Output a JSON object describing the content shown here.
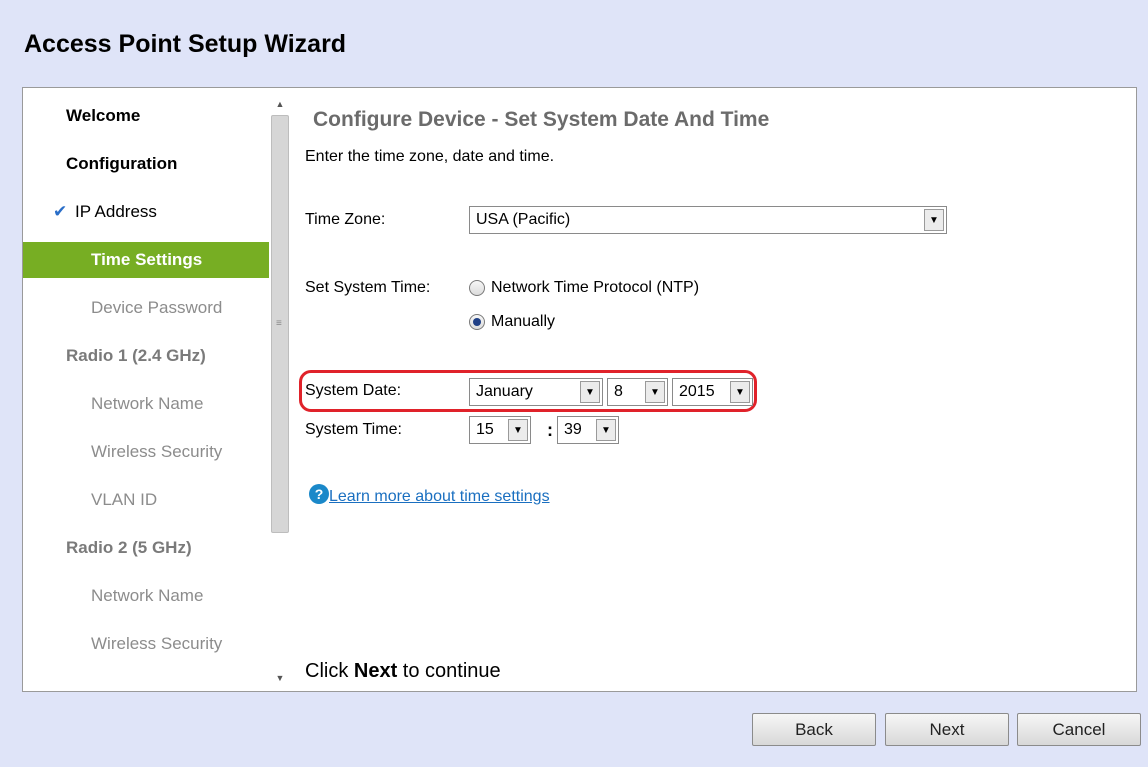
{
  "window": {
    "title": "Access Point Setup Wizard"
  },
  "sidebar": {
    "items": [
      {
        "label": "Welcome"
      },
      {
        "label": "Configuration"
      },
      {
        "label": "IP Address"
      },
      {
        "label": "Time Settings"
      },
      {
        "label": "Device Password"
      },
      {
        "label": "Radio 1 (2.4 GHz)"
      },
      {
        "label": "Network Name"
      },
      {
        "label": "Wireless Security"
      },
      {
        "label": "VLAN ID"
      },
      {
        "label": "Radio 2 (5 GHz)"
      },
      {
        "label": "Network Name"
      },
      {
        "label": "Wireless Security"
      }
    ],
    "check_glyph": "✔"
  },
  "content": {
    "heading": "Configure Device - Set System Date And Time",
    "description": "Enter the time zone, date and time.",
    "time_zone": {
      "label": "Time Zone:",
      "value": "USA (Pacific)"
    },
    "set_system_time": {
      "label": "Set System Time:",
      "options": [
        "Network Time Protocol (NTP)",
        "Manually"
      ],
      "selected": "Manually"
    },
    "system_date": {
      "label": "System Date:",
      "month": "January",
      "day": "8",
      "year": "2015"
    },
    "system_time": {
      "label": "System Time:",
      "hour": "15",
      "separator": ":",
      "minute": "39"
    },
    "help_link": "Learn more about time settings",
    "footer": {
      "prefix": "Click ",
      "emphasis": "Next",
      "suffix": " to continue"
    }
  },
  "buttons": {
    "back": "Back",
    "next": "Next",
    "cancel": "Cancel"
  },
  "colors": {
    "active_nav": "#77ae23",
    "highlight": "#e0222a",
    "link": "#1a6fc0",
    "background": "#dfe4f8"
  }
}
